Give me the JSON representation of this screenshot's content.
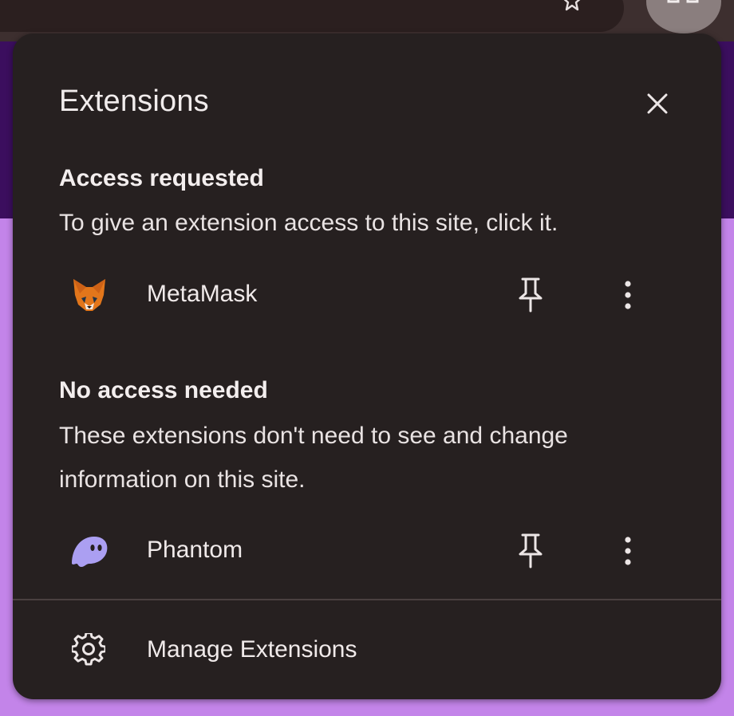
{
  "popup": {
    "title": "Extensions",
    "close_icon": "close-icon"
  },
  "access_requested": {
    "heading": "Access requested",
    "description": "To give an extension access to this site, click it.",
    "items": [
      {
        "name": "MetaMask",
        "icon": "metamask-fox-icon",
        "pin_icon": "pin-icon",
        "more_icon": "more-vert-icon"
      }
    ]
  },
  "no_access_needed": {
    "heading": "No access needed",
    "description": "These extensions don't need to see and change information on this site.",
    "items": [
      {
        "name": "Phantom",
        "icon": "phantom-ghost-icon",
        "pin_icon": "pin-icon",
        "more_icon": "more-vert-icon"
      }
    ]
  },
  "footer": {
    "manage_label": "Manage Extensions",
    "icon": "gear-icon"
  },
  "colors": {
    "popup_bg": "#262020",
    "page_bg": "#c384e9",
    "text": "#f0eaea",
    "phantom": "#ab9ff2",
    "metamask": "#e2761b"
  }
}
